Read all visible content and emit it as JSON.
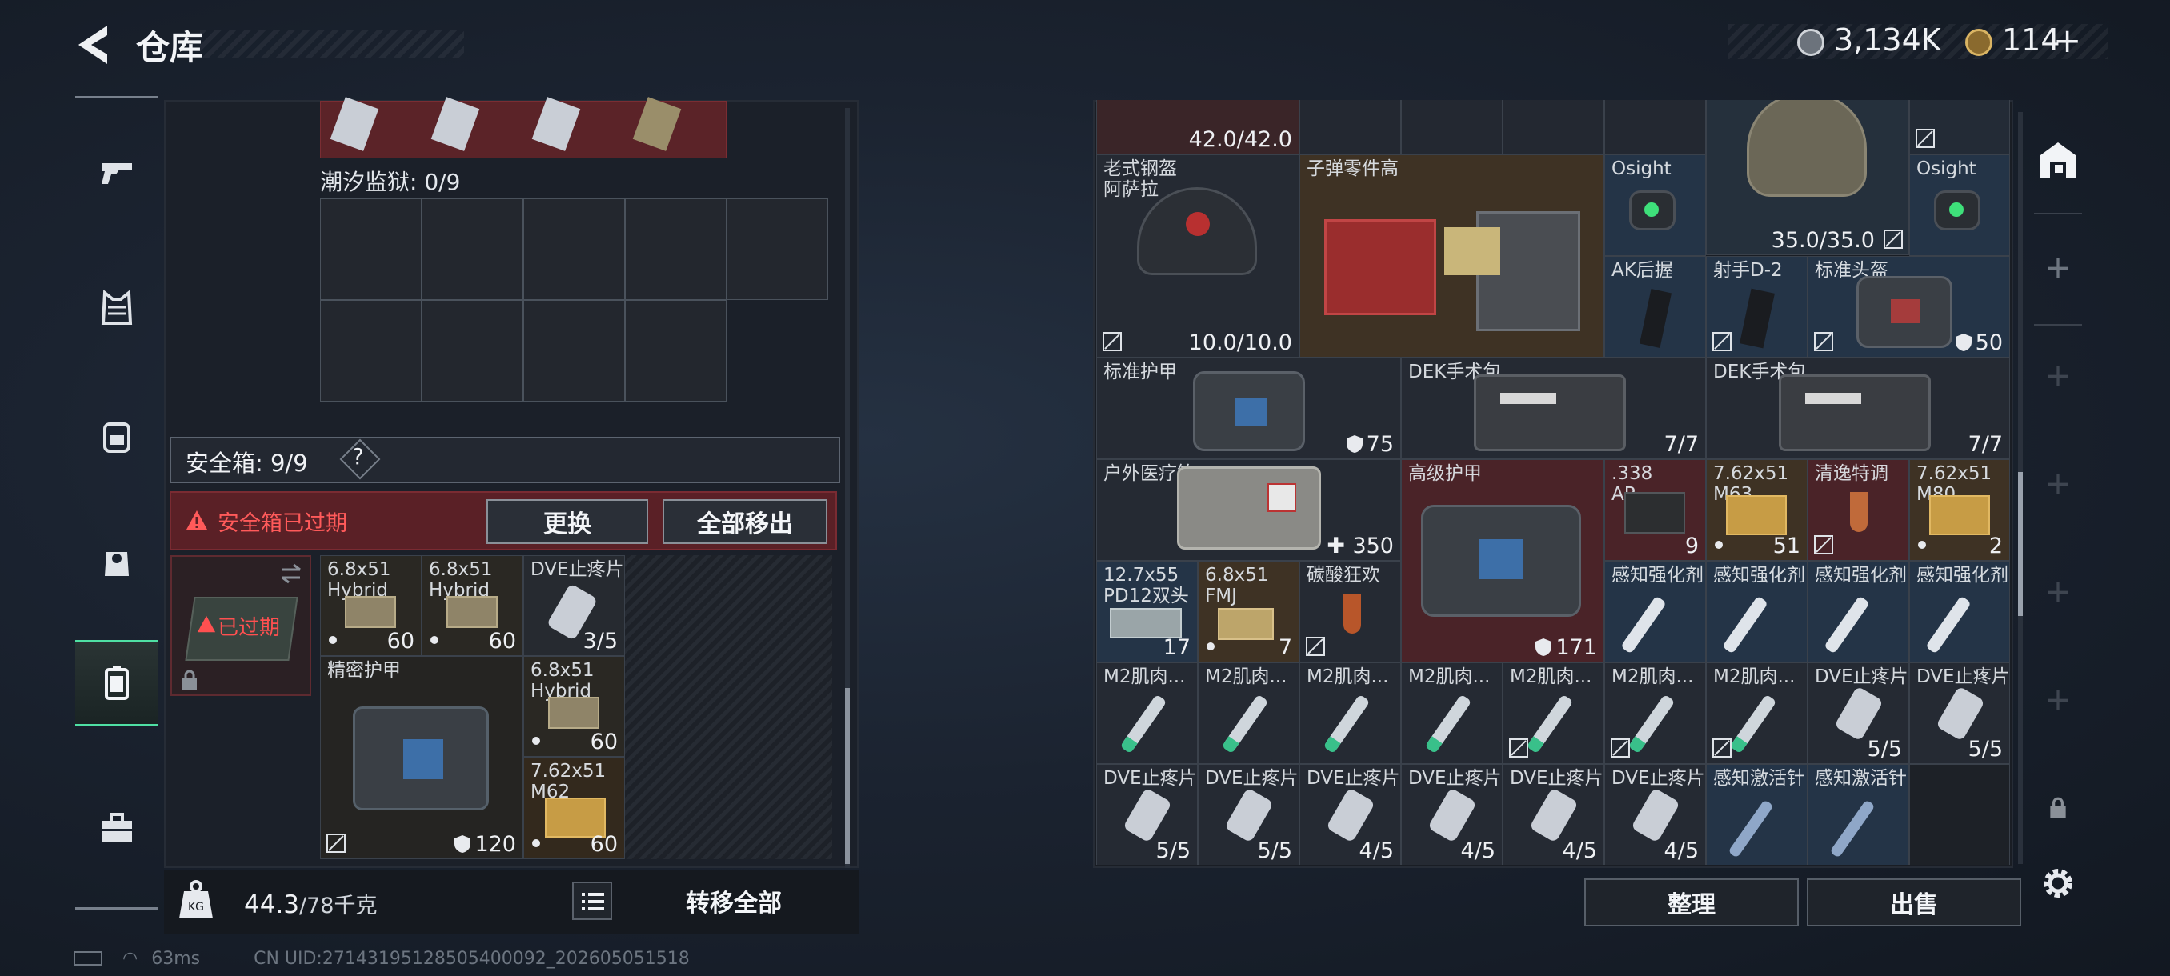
{
  "header": {
    "title": "仓库",
    "currency_silver": "3,134K",
    "currency_gold": "114",
    "add_symbol": "+"
  },
  "nav": {
    "items": [
      "weapons",
      "armor",
      "backpack",
      "vest",
      "safebox",
      "tools"
    ]
  },
  "left": {
    "tide_prison_label": "潮汐监狱: 0/9",
    "safe_box_label": "安全箱: 9/9",
    "help_symbol": "?",
    "expired_notice": "安全箱已过期",
    "replace_button": "更换",
    "remove_all_button": "全部移出",
    "safebox_expired": "已过期",
    "items": [
      {
        "name": "6.8x51\nHybrid",
        "value": "60"
      },
      {
        "name": "6.8x51\nHybrid",
        "value": "60"
      },
      {
        "name": "DVE止疼片",
        "value": "3/5"
      },
      {
        "name": "精密护甲",
        "value": "120"
      },
      {
        "name": "6.8x51\nHybrid",
        "value": "60"
      },
      {
        "name": "7.62x51\nM62",
        "value": "60"
      }
    ],
    "weight_value": "44.3",
    "weight_total": "/78千克",
    "transfer_all_button": "转移全部"
  },
  "right": {
    "top_durability_1": "42.0/42.0",
    "items": [
      {
        "name": "老式钢盔\n阿萨拉",
        "value": "10.0/10.0"
      },
      {
        "name": "子弹零件高",
        "value": ""
      },
      {
        "name": "Osight",
        "value": ""
      },
      {
        "name": "",
        "value": "35.0/35.0"
      },
      {
        "name": "Osight",
        "value": ""
      },
      {
        "name": "AK后握",
        "value": ""
      },
      {
        "name": "射手D-2",
        "value": ""
      },
      {
        "name": "标准头盔",
        "value": "50"
      },
      {
        "name": "标准护甲",
        "value": "75"
      },
      {
        "name": "DEK手术包",
        "value": "7/7"
      },
      {
        "name": "DEK手术包",
        "value": "7/7"
      },
      {
        "name": "户外医疗箱",
        "value": "350"
      },
      {
        "name": "高级护甲",
        "value": "171"
      },
      {
        "name": ".338\nAP",
        "value": "9"
      },
      {
        "name": "7.62x51\nM63",
        "value": "51"
      },
      {
        "name": "清逸特调",
        "value": ""
      },
      {
        "name": "7.62x51\nM80",
        "value": "2"
      },
      {
        "name": "12.7x55\nPD12双头",
        "value": "17"
      },
      {
        "name": "6.8x51\nFMJ",
        "value": "7"
      },
      {
        "name": "碳酸狂欢",
        "value": ""
      },
      {
        "name": "感知强化剂",
        "value": ""
      },
      {
        "name": "感知强化剂",
        "value": ""
      },
      {
        "name": "感知强化剂",
        "value": ""
      },
      {
        "name": "感知强化剂",
        "value": ""
      },
      {
        "name": "M2肌肉...",
        "value": ""
      },
      {
        "name": "M2肌肉...",
        "value": ""
      },
      {
        "name": "M2肌肉...",
        "value": ""
      },
      {
        "name": "M2肌肉...",
        "value": ""
      },
      {
        "name": "M2肌肉...",
        "value": ""
      },
      {
        "name": "M2肌肉...",
        "value": ""
      },
      {
        "name": "M2肌肉...",
        "value": ""
      },
      {
        "name": "DVE止疼片",
        "value": "5/5"
      },
      {
        "name": "DVE止疼片",
        "value": "5/5"
      },
      {
        "name": "DVE止疼片",
        "value": "5/5"
      },
      {
        "name": "DVE止疼片",
        "value": "5/5"
      },
      {
        "name": "DVE止疼片",
        "value": "4/5"
      },
      {
        "name": "DVE止疼片",
        "value": "4/5"
      },
      {
        "name": "DVE止疼片",
        "value": "4/5"
      },
      {
        "name": "DVE止疼片",
        "value": "4/5"
      },
      {
        "name": "感知激活针",
        "value": ""
      },
      {
        "name": "感知激活针",
        "value": ""
      }
    ],
    "sort_button": "整理",
    "sell_button": "出售"
  },
  "status": {
    "ping": "63ms",
    "uid": "CN UID:27143195128505400092_202605051518"
  },
  "colors": {
    "accent_green": "#4fe0a4",
    "expired_red": "#ff5050",
    "rare_red": "#5a2328",
    "gold_rarity": "#3e3224",
    "blue_rarity": "#243447"
  }
}
